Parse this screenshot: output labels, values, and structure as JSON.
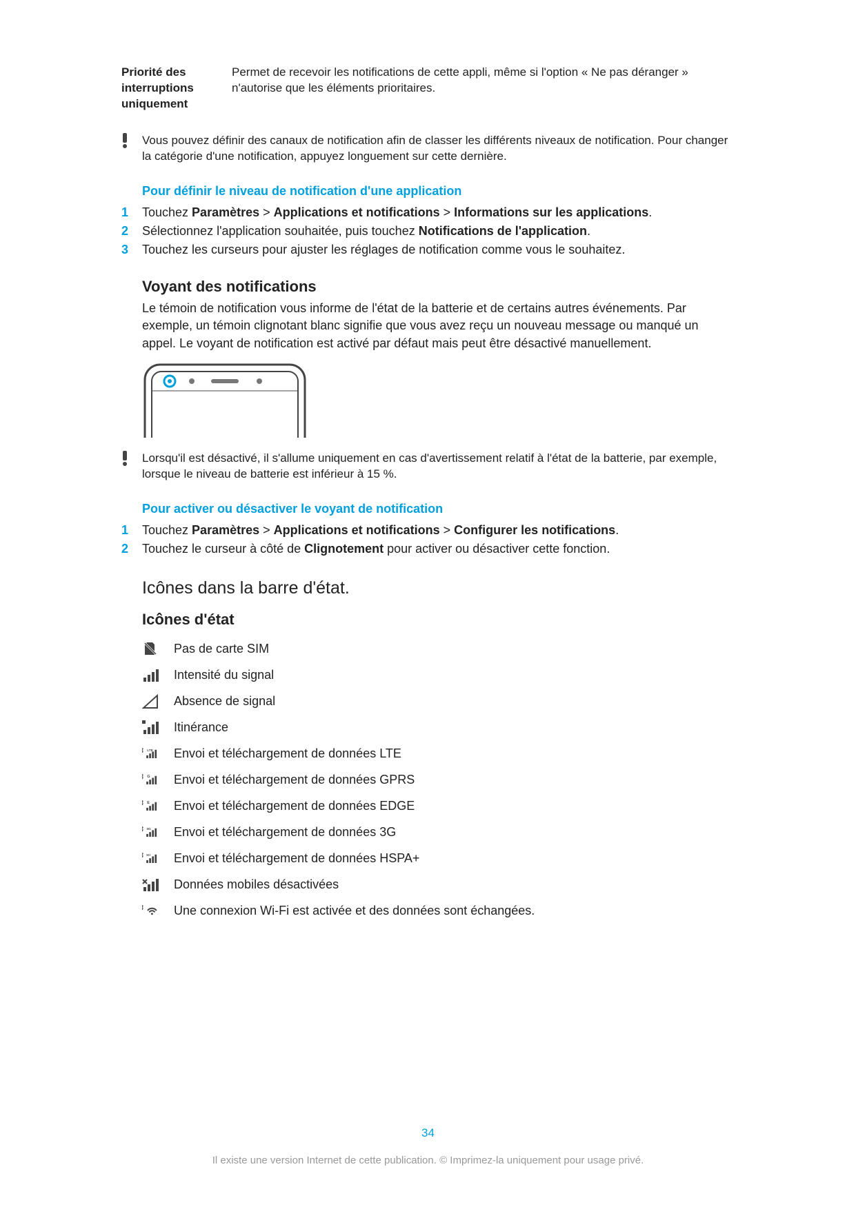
{
  "option": {
    "label": "Priorité des interruptions uniquement",
    "desc": "Permet de recevoir les notifications de cette appli, même si l'option « Ne pas déranger » n'autorise que les éléments prioritaires."
  },
  "note1": "Vous pouvez définir des canaux de notification afin de classer les différents niveaux de notification. Pour changer la catégorie d'une notification, appuyez longuement sur cette dernière.",
  "proc1": {
    "title": "Pour définir le niveau de notification d'une application",
    "steps": [
      "Touchez <b>Paramètres</b> > <b>Applications et notifications</b> > <b>Informations sur les applications</b>.",
      "Sélectionnez l'application souhaitée, puis touchez <b>Notifications de l'application</b>.",
      "Touchez les curseurs pour ajuster les réglages de notification comme vous le souhaitez."
    ]
  },
  "section_led": {
    "title": "Voyant des notifications",
    "body": "Le témoin de notification vous informe de l'état de la batterie et de certains autres événements. Par exemple, un témoin clignotant blanc signifie que vous avez reçu un nouveau message ou manqué un appel. Le voyant de notification est activé par défaut mais peut être désactivé manuellement."
  },
  "note2": "Lorsqu'il est désactivé, il s'allume uniquement en cas d'avertissement relatif à l'état de la batterie, par exemple, lorsque le niveau de batterie est inférieur à 15 %.",
  "proc2": {
    "title": "Pour activer ou désactiver le voyant de notification",
    "steps": [
      "Touchez <b>Paramètres</b> > <b>Applications et notifications</b> > <b>Configurer les notifications</b>.",
      "Touchez le curseur à côté de <b>Clignotement</b> pour activer ou désactiver cette fonction."
    ]
  },
  "status_section": {
    "title": "Icônes dans la barre d'état.",
    "subtitle": "Icônes d'état",
    "rows": [
      {
        "icon": "no-sim",
        "label": "Pas de carte SIM"
      },
      {
        "icon": "signal",
        "label": "Intensité du signal"
      },
      {
        "icon": "nosignal",
        "label": "Absence de signal"
      },
      {
        "icon": "roaming",
        "label": "Itinérance"
      },
      {
        "icon": "data-lte",
        "label": "Envoi et téléchargement de données LTE"
      },
      {
        "icon": "data-g",
        "label": "Envoi et téléchargement de données GPRS"
      },
      {
        "icon": "data-e",
        "label": "Envoi et téléchargement de données EDGE"
      },
      {
        "icon": "data-3g",
        "label": "Envoi et téléchargement de données 3G"
      },
      {
        "icon": "data-hplus",
        "label": "Envoi et téléchargement de données HSPA+"
      },
      {
        "icon": "data-off",
        "label": "Données mobiles désactivées"
      },
      {
        "icon": "wifi-data",
        "label": "Une connexion Wi-Fi est activée et des données sont échangées."
      }
    ]
  },
  "pagenum": "34",
  "footnote": "Il existe une version Internet de cette publication. © Imprimez-la uniquement pour usage privé."
}
